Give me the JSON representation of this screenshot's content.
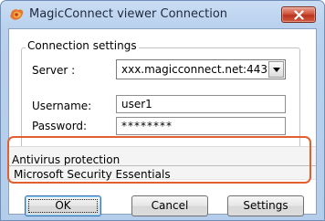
{
  "window": {
    "title": "MagicConnect viewer Connection",
    "app_icon": "magicconnect-logo-icon",
    "close_icon": "close-icon"
  },
  "connection_settings": {
    "legend": "Connection settings",
    "server_label": "Server :",
    "server_value": "xxx.magicconnect.net:443",
    "server_dropdown_icon": "chevron-down-icon",
    "username_label": "Username:",
    "username_value": "user1",
    "password_label": "Password:",
    "password_value": "********"
  },
  "antivirus": {
    "title": "Antivirus protection",
    "value": "Microsoft Security Essentials"
  },
  "buttons": {
    "ok": "OK",
    "cancel": "Cancel",
    "settings": "Settings"
  },
  "colors": {
    "highlight": "#e0602f",
    "titlebar": "#b9d1ee",
    "close_button": "#c8442c"
  }
}
